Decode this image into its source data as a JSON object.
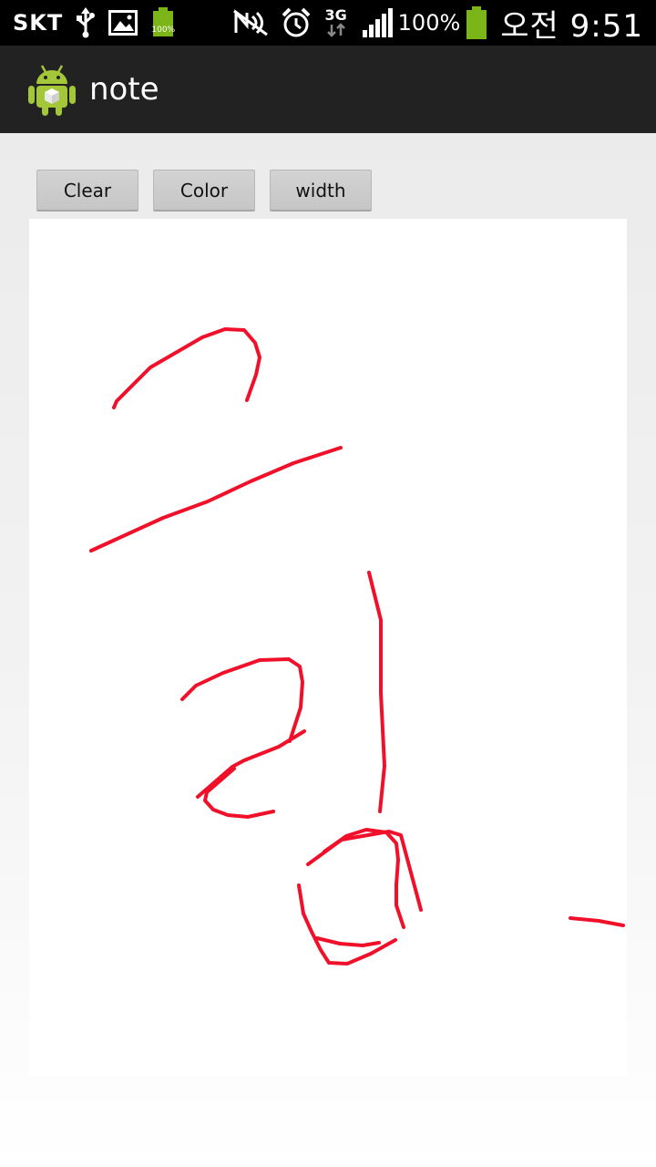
{
  "status_bar": {
    "carrier": "SKT",
    "network": "3G",
    "signal_percent": "100%",
    "battery_percent": "100%",
    "battery_badge": "100%",
    "time": "오전 9:51"
  },
  "action_bar": {
    "title": "note",
    "icon": "android-icon"
  },
  "toolbar": {
    "clear_label": "Clear",
    "color_label": "Color",
    "width_label": "width"
  },
  "canvas": {
    "stroke_color": "#f0102a",
    "background": "#ffffff"
  },
  "colors": {
    "action_bar_bg": "#222222",
    "status_bar_bg": "#000000",
    "battery_green": "#7cb518",
    "button_bg": "#cccccc"
  }
}
